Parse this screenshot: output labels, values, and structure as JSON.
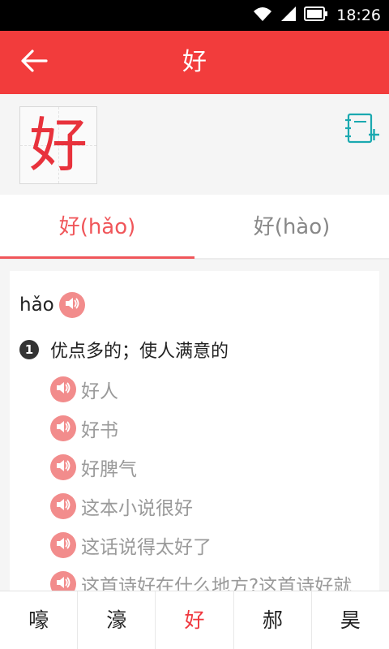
{
  "status_bar": {
    "time": "18:26"
  },
  "app_bar": {
    "title": "好"
  },
  "character": {
    "glyph": "好"
  },
  "tabs": [
    {
      "label": "好(hǎo)",
      "active": true
    },
    {
      "label": "好(hào)",
      "active": false
    }
  ],
  "definition": {
    "pinyin": "hǎo",
    "senses": [
      {
        "number": "1",
        "text": "优点多的；使人满意的",
        "examples": [
          "好人",
          "好书",
          "好脾气",
          "这本小说很好",
          "这话说得太好了",
          "这首诗好在什么地方?这首诗好就"
        ]
      }
    ]
  },
  "bottom_nav": [
    {
      "label": "嚎",
      "active": false
    },
    {
      "label": "濠",
      "active": false
    },
    {
      "label": "好",
      "active": true
    },
    {
      "label": "郝",
      "active": false
    },
    {
      "label": "昊",
      "active": false
    }
  ],
  "colors": {
    "accent": "#f23c3c",
    "speaker": "#f28c8c",
    "notebook": "#1aa9b0"
  },
  "icons": [
    "wifi-icon",
    "signal-icon",
    "battery-icon",
    "back-arrow-icon",
    "notebook-add-icon",
    "speaker-icon"
  ]
}
